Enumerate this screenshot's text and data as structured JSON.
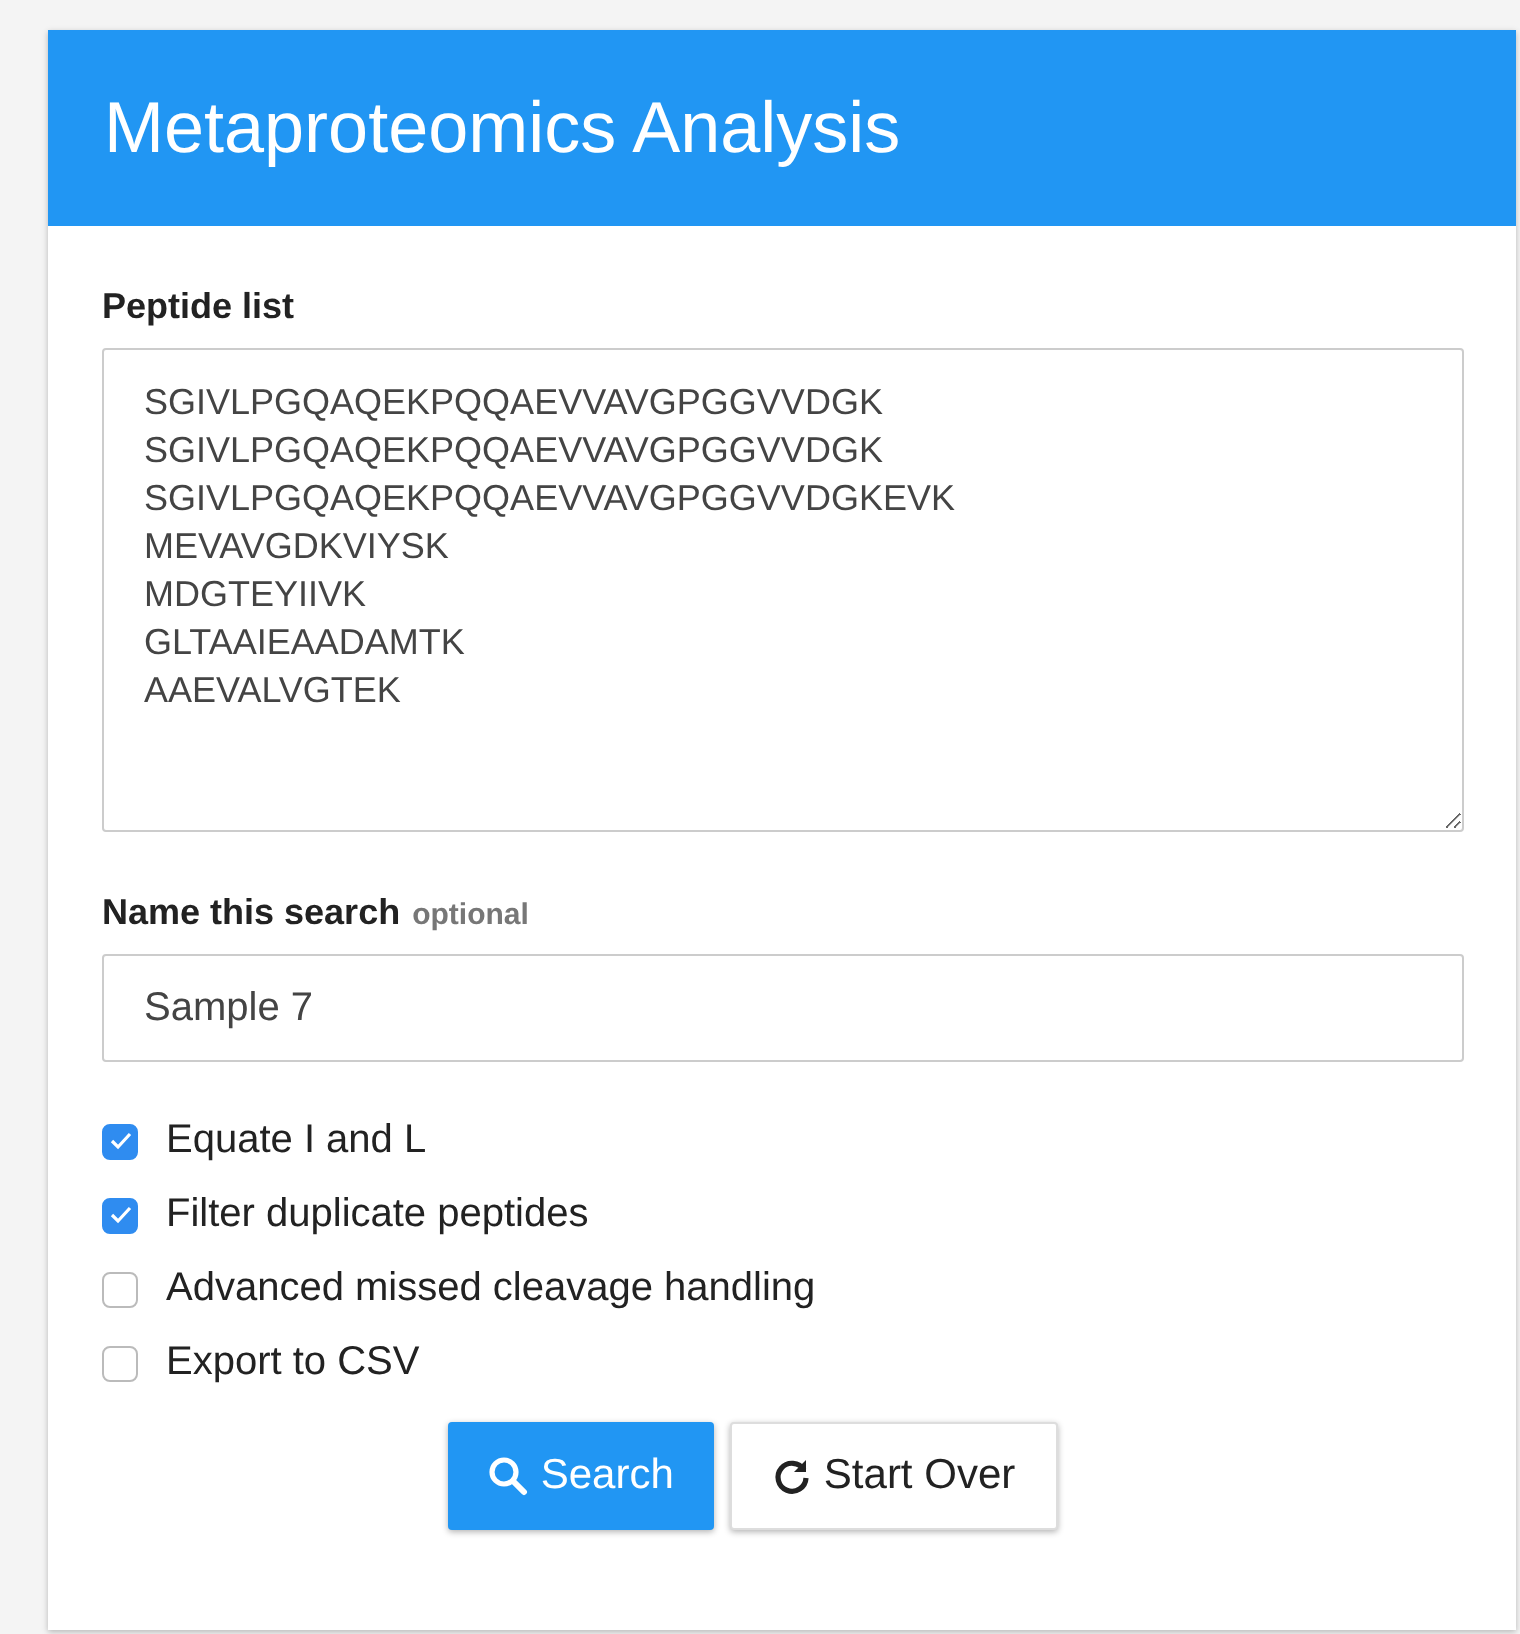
{
  "header": {
    "title": "Metaproteomics Analysis"
  },
  "peptide_list": {
    "label": "Peptide list",
    "lines": [
      "SGIVLPGQAQEKPQQAEVVAVGPGGVVDGK",
      "SGIVLPGQAQEKPQQAEVVAVGPGGVVDGK",
      "SGIVLPGQAQEKPQQAEVVAVGPGGVVDGKEVK",
      "MEVAVGDKVIYSK",
      "MDGTEYIIVK",
      "GLTAAIEAADAMTK",
      "AAEVALVGTEK"
    ]
  },
  "search_name": {
    "label": "Name this search",
    "hint": "optional",
    "value": "Sample 7"
  },
  "options": [
    {
      "label": "Equate I and L",
      "checked": true
    },
    {
      "label": "Filter duplicate peptides",
      "checked": true
    },
    {
      "label": "Advanced missed cleavage handling",
      "checked": false
    },
    {
      "label": "Export to CSV",
      "checked": false
    }
  ],
  "buttons": [
    {
      "label": "Search",
      "kind": "primary"
    },
    {
      "label": "Start Over",
      "kind": "default"
    }
  ]
}
